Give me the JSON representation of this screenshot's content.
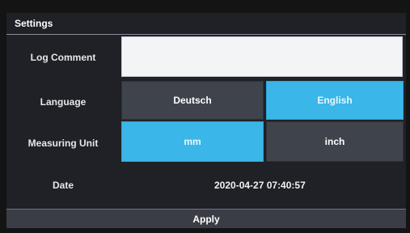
{
  "window": {
    "title": "Settings"
  },
  "form": {
    "log_comment": {
      "label": "Log Comment",
      "value": ""
    },
    "language": {
      "label": "Language",
      "options": [
        "Deutsch",
        "English"
      ],
      "selected": "English"
    },
    "measuring_unit": {
      "label": "Measuring Unit",
      "options": [
        "mm",
        "inch"
      ],
      "selected": "mm"
    },
    "date": {
      "label": "Date",
      "value": "2020-04-27 07:40:57"
    }
  },
  "actions": {
    "apply_label": "Apply"
  },
  "colors": {
    "selected_option": "#3bb6e8",
    "unselected_option": "#3f434c",
    "background": "#1f2126"
  }
}
